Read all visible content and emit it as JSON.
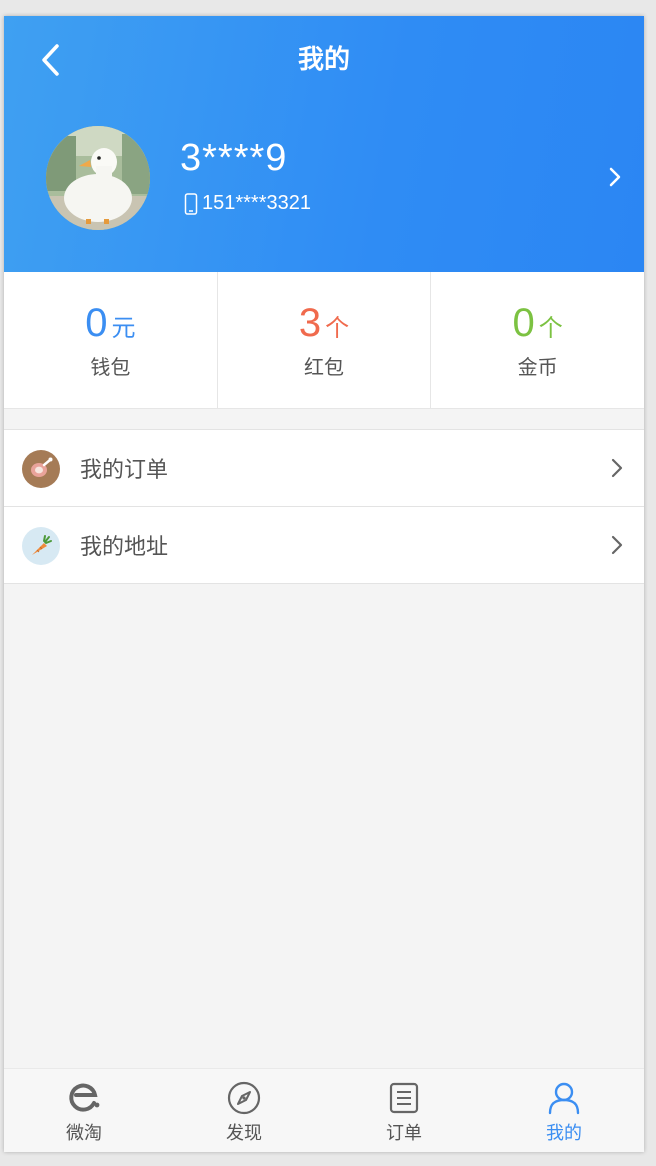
{
  "header": {
    "title": "我的",
    "username": "3****9",
    "phone": "151****3321"
  },
  "stats": [
    {
      "value": "0",
      "unit": "元",
      "label": "钱包",
      "color": "#3b8ef2"
    },
    {
      "value": "3",
      "unit": "个",
      "label": "红包",
      "color": "#f06a4d"
    },
    {
      "value": "0",
      "unit": "个",
      "label": "金币",
      "color": "#7cc242"
    }
  ],
  "menu": [
    {
      "label": "我的订单",
      "icon": "ham-icon"
    },
    {
      "label": "我的地址",
      "icon": "carrot-icon"
    }
  ],
  "tabbar": [
    {
      "label": "微淘",
      "icon": "e-logo-icon"
    },
    {
      "label": "发现",
      "icon": "compass-icon"
    },
    {
      "label": "订单",
      "icon": "order-list-icon"
    },
    {
      "label": "我的",
      "icon": "user-icon",
      "active": true
    }
  ],
  "colors": {
    "accent": "#3b8ef2",
    "header_gradient_start": "#3fa0f2",
    "header_gradient_end": "#2b86f3",
    "background": "#f4f4f4"
  }
}
